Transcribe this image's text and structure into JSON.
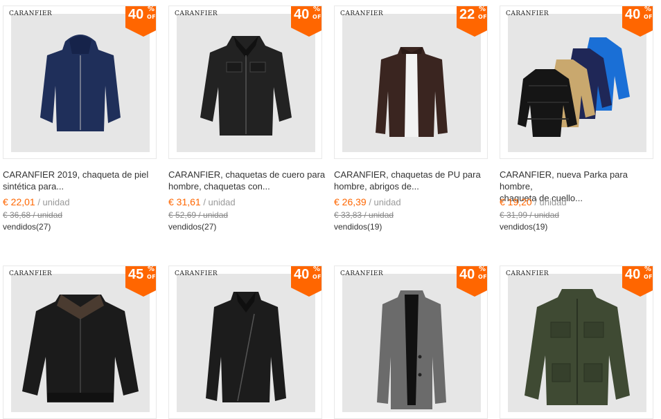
{
  "colors": {
    "accent": "#ff6600",
    "badge_text": "#ffffff",
    "muted": "#999999"
  },
  "products": [
    {
      "brand": "CARANFIER",
      "discount": "40",
      "percent_sign": "%",
      "off_label": "OFF",
      "title_line1": "CARANFIER 2019, chaqueta de piel",
      "title_line2": "sintética para...",
      "price": "€ 22,01",
      "unit": " / unidad",
      "old_price": "€ 36,68 / unidad",
      "sold": "vendidos(27)",
      "image_icon": "navy-hooded-leather-jacket-icon"
    },
    {
      "brand": "CARANFIER",
      "discount": "40",
      "percent_sign": "%",
      "off_label": "OFF",
      "title_line1": "CARANFIER, chaquetas de cuero para",
      "title_line2": "hombre, chaquetas con...",
      "price": "€ 31,61",
      "unit": " / unidad",
      "old_price": "€ 52,69 / unidad",
      "sold": "vendidos(27)",
      "image_icon": "black-leather-jacket-icon"
    },
    {
      "brand": "CARANFIER",
      "discount": "22",
      "percent_sign": "%",
      "off_label": "OFF",
      "title_line1": "CARANFIER, chaquetas de PU para",
      "title_line2": "hombre, abrigos de...",
      "price": "€ 26,39",
      "unit": " / unidad",
      "old_price": "€ 33,83 / unidad",
      "sold": "vendidos(19)",
      "image_icon": "brown-pu-jacket-icon"
    },
    {
      "brand": "CARANFIER",
      "discount": "40",
      "percent_sign": "%",
      "off_label": "OFF",
      "title_line1": "CARANFIER, nueva Parka para hombre,",
      "title_line2": "chaqueta de cuello...",
      "price": "€ 19,20",
      "unit": " / unidad",
      "old_price": "€ 31,99 / unidad",
      "sold": "vendidos(19)",
      "image_icon": "puffer-parkas-icon"
    },
    {
      "brand": "CARANFIER",
      "discount": "45",
      "percent_sign": "%",
      "off_label": "OFF",
      "image_icon": "black-leather-bomber-icon"
    },
    {
      "brand": "CARANFIER",
      "discount": "40",
      "percent_sign": "%",
      "off_label": "OFF",
      "image_icon": "black-moto-leather-jacket-icon"
    },
    {
      "brand": "CARANFIER",
      "discount": "40",
      "percent_sign": "%",
      "off_label": "OFF",
      "image_icon": "grey-wool-coat-icon"
    },
    {
      "brand": "CARANFIER",
      "discount": "40",
      "percent_sign": "%",
      "off_label": "OFF",
      "image_icon": "green-field-jacket-icon"
    }
  ]
}
